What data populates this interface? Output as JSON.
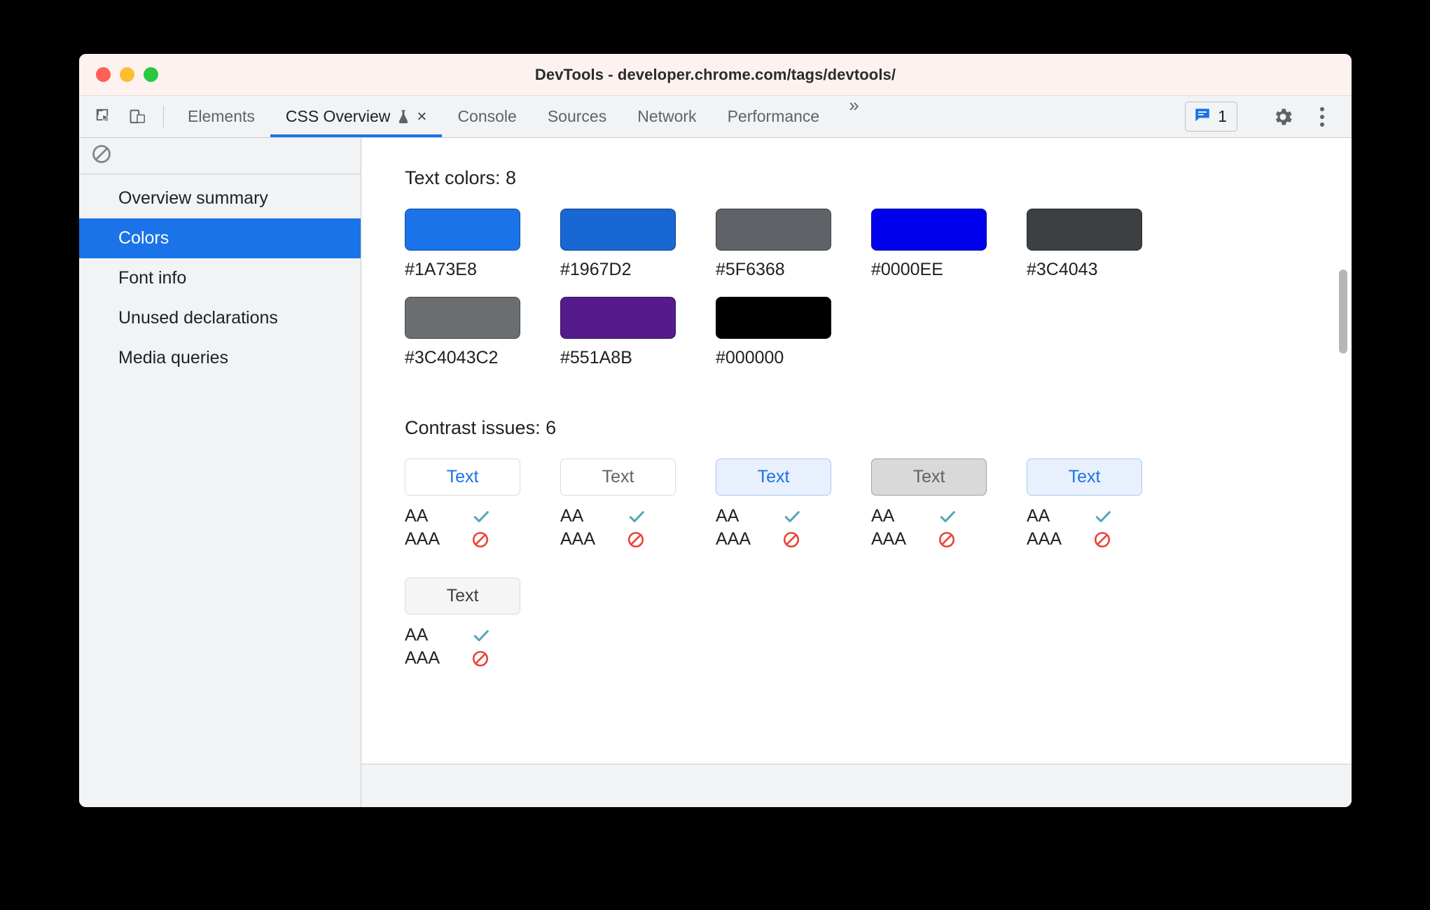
{
  "window": {
    "title": "DevTools - developer.chrome.com/tags/devtools/",
    "traffic_lights": [
      "close",
      "minimize",
      "zoom"
    ]
  },
  "toolbar": {
    "inspect_icon": "inspect-cursor-icon",
    "device_toggle_icon": "device-toolbar-icon",
    "tabs": [
      {
        "label": "Elements",
        "selected": false,
        "closable": false
      },
      {
        "label": "CSS Overview",
        "selected": true,
        "closable": true,
        "experiment_icon": "flask-icon",
        "close_label": "×"
      },
      {
        "label": "Console",
        "selected": false,
        "closable": false
      },
      {
        "label": "Sources",
        "selected": false,
        "closable": false
      },
      {
        "label": "Network",
        "selected": false,
        "closable": false
      },
      {
        "label": "Performance",
        "selected": false,
        "closable": false
      }
    ],
    "overflow_label": "»",
    "issues": {
      "icon": "issues-message-icon",
      "count": "1"
    },
    "settings_icon": "gear-icon",
    "more_icon": "vertical-dots-icon",
    "accent_color": "#1A73E8"
  },
  "sidebar": {
    "clear_icon": "no-entry-clear-overview-icon",
    "items": [
      {
        "label": "Overview summary",
        "selected": false
      },
      {
        "label": "Colors",
        "selected": true
      },
      {
        "label": "Font info",
        "selected": false
      },
      {
        "label": "Unused declarations",
        "selected": false
      },
      {
        "label": "Media queries",
        "selected": false
      }
    ],
    "selected_bg": "#1A73E8"
  },
  "content": {
    "text_colors": {
      "title": "Text colors: 8",
      "swatches": [
        {
          "hex": "#1A73E8",
          "label": "#1A73E8"
        },
        {
          "hex": "#1967D2",
          "label": "#1967D2"
        },
        {
          "hex": "#5F6368",
          "label": "#5F6368"
        },
        {
          "hex": "#0000EE",
          "label": "#0000EE"
        },
        {
          "hex": "#3C4043",
          "label": "#3C4043"
        },
        {
          "hex": "#3C4043C2",
          "label": "#3C4043C2"
        },
        {
          "hex": "#551A8B",
          "label": "#551A8B"
        },
        {
          "hex": "#000000",
          "label": "#000000"
        }
      ]
    },
    "contrast_issues": {
      "title": "Contrast issues: 6",
      "aa_label": "AA",
      "aaa_label": "AAA",
      "pass_icon": "check-icon",
      "fail_icon": "no-entry-icon",
      "pass_color": "#58A6B5",
      "fail_color": "#EA4335",
      "cards": [
        {
          "sample_text": "Text",
          "text_color": "#1A73E8",
          "bg_color": "#FFFFFF",
          "border_color": "#DADCE0",
          "aa": "pass",
          "aaa": "fail"
        },
        {
          "sample_text": "Text",
          "text_color": "#5F6368",
          "bg_color": "#FFFFFF",
          "border_color": "#DADCE0",
          "aa": "pass",
          "aaa": "fail"
        },
        {
          "sample_text": "Text",
          "text_color": "#1A73E8",
          "bg_color": "#E8F0FE",
          "border_color": "#A8C7FA",
          "aa": "pass",
          "aaa": "fail"
        },
        {
          "sample_text": "Text",
          "text_color": "#5F6368",
          "bg_color": "#D9D9D9",
          "border_color": "#9AA0A6",
          "aa": "pass",
          "aaa": "fail"
        },
        {
          "sample_text": "Text",
          "text_color": "#1A73E8",
          "bg_color": "#E8F0FE",
          "border_color": "#A8C7FA",
          "aa": "pass",
          "aaa": "fail"
        },
        {
          "sample_text": "Text",
          "text_color": "#3C4043",
          "bg_color": "#F5F5F5",
          "border_color": "#DADCE0",
          "aa": "pass",
          "aaa": "fail"
        }
      ]
    }
  }
}
